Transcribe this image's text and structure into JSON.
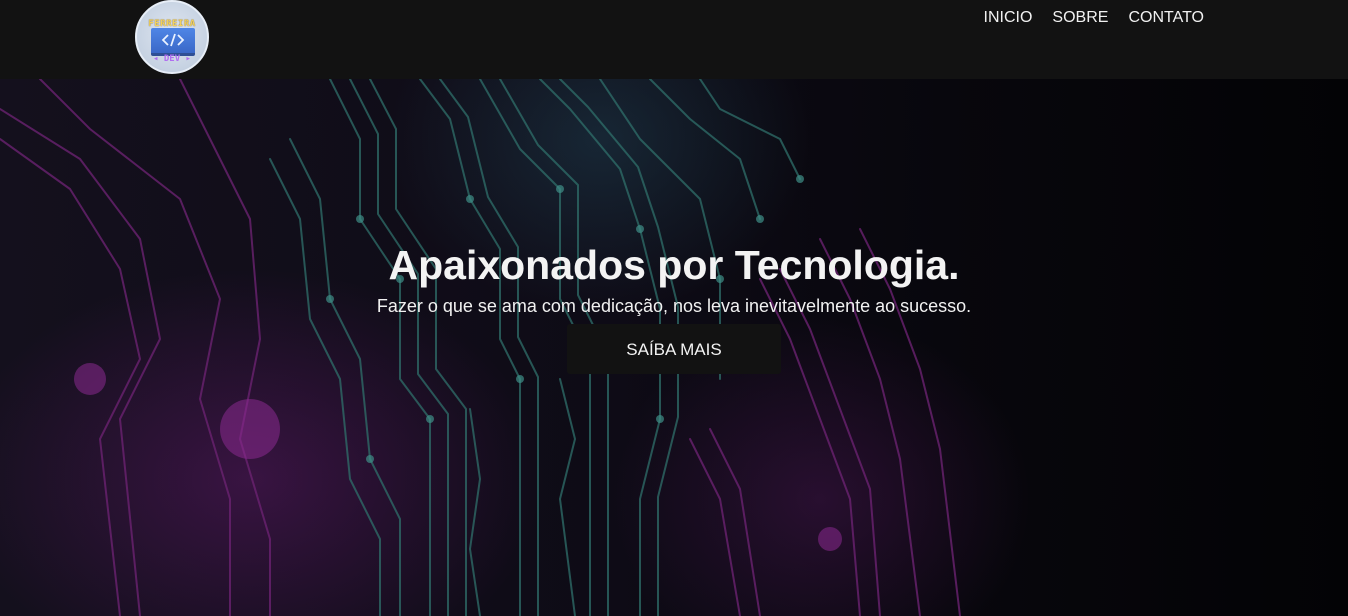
{
  "header": {
    "logo": {
      "top_text": "FERREIRA",
      "bottom_text": "◂ DEV ▸",
      "icon": "code-brackets-icon"
    },
    "nav": [
      {
        "label": "INICIO"
      },
      {
        "label": "SOBRE"
      },
      {
        "label": "CONTATO"
      }
    ]
  },
  "hero": {
    "title": "Apaixonados por Tecnologia.",
    "subtitle": "Fazer o que se ama com dedicação, nos leva inevitavelmente ao sucesso.",
    "button_label": "SAÍBA MAIS",
    "background": "circuit-board-image"
  },
  "colors": {
    "navbar_bg": "#121212",
    "button_bg": "#121212",
    "text": "#f3f3f3",
    "circuit_teal": "#3f8f88",
    "circuit_purple": "#8a2a8f"
  }
}
